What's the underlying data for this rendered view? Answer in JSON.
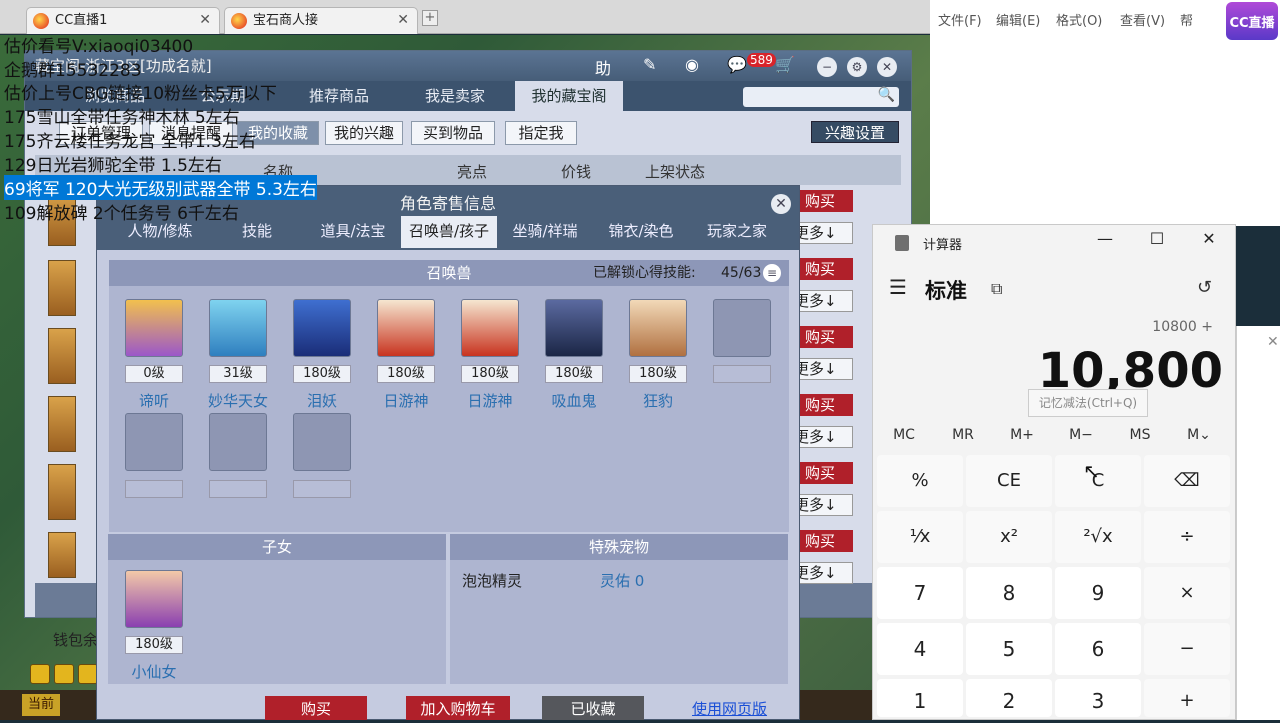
{
  "browser": {
    "tabs": [
      {
        "label": "CC直播1"
      },
      {
        "label": "宝石商人接"
      }
    ],
    "new_tab": "+"
  },
  "main_window": {
    "title": "藏宝阁-浙江3区[功成名就]",
    "help_label": "助",
    "cart_count": "589",
    "nav_tabs": [
      "浏览商品",
      "公示期",
      "推荐商品",
      "我是卖家",
      "我的藏宝阁"
    ],
    "sub_buttons": [
      "订单管理",
      "消息提醒",
      "我的收藏",
      "我的兴趣",
      "买到物品",
      "指定我"
    ],
    "interest_settings": "兴趣设置",
    "columns": [
      "名称",
      "亮点",
      "价钱",
      "上架状态"
    ],
    "buy_label": "购买",
    "more_label": "更多↓",
    "footer_text": "钱包余",
    "footer_btn": "当前"
  },
  "dialog": {
    "title": "角色寄售信息",
    "tabs": [
      "人物/修炼",
      "技能",
      "道具/法宝",
      "召唤兽/孩子",
      "坐骑/祥瑞",
      "锦衣/染色",
      "玩家之家"
    ],
    "pets_section": "召唤兽",
    "unlocked_label": "已解锁心得技能:",
    "unlocked_value": "45/63",
    "pets": [
      {
        "level": "0级",
        "name": "谛听"
      },
      {
        "level": "31级",
        "name": "妙华天女"
      },
      {
        "level": "180级",
        "name": "泪妖"
      },
      {
        "level": "180级",
        "name": "日游神"
      },
      {
        "level": "180级",
        "name": "日游神"
      },
      {
        "level": "180级",
        "name": "吸血鬼"
      },
      {
        "level": "180级",
        "name": "狂豹"
      }
    ],
    "children_section": "子女",
    "child": {
      "level": "180级",
      "name": "小仙女"
    },
    "special_section": "特殊宠物",
    "special_name": "泡泡精灵",
    "special_value": "灵佑 0",
    "buttons": {
      "buy": "购买",
      "cart": "加入购物车",
      "favorited": "已收藏",
      "web": "使用网页版"
    }
  },
  "notepad": {
    "menu": [
      "文件(F)",
      "编辑(E)",
      "格式(O)",
      "查看(V)",
      "帮"
    ],
    "lines": [
      "估价看号V:xiaoqi03400",
      "企鹅群15532283",
      "估价上号CBG链接10粉丝卡5万以下",
      "175雪山全带任务神木林 5左右",
      "175齐云楼任务龙宫  全带1.3左右",
      "129日光岩狮驼全带  1.5左右",
      "69将军 120大光无级别武器全带 5.3左右",
      "109解放碑 2个任务号 6千左右"
    ],
    "selected_line": 6
  },
  "watermark": "CC直播",
  "calculator": {
    "title": "计算器",
    "mode": "标准",
    "expression": "10800 +",
    "display": "10,800",
    "tooltip": "记忆减法(Ctrl+Q)",
    "memory": [
      "MC",
      "MR",
      "M+",
      "M−",
      "MS",
      "M⌄"
    ],
    "keys": [
      "%",
      "CE",
      "C",
      "⌫",
      "¹⁄x",
      "x²",
      "²√x",
      "÷",
      "7",
      "8",
      "9",
      "×",
      "4",
      "5",
      "6",
      "−",
      "1",
      "2",
      "3",
      "+"
    ]
  },
  "colors": {
    "buy_red": "#b0202a",
    "selection_blue": "#0078d7",
    "pet_name_blue": "#2a6fb0"
  }
}
